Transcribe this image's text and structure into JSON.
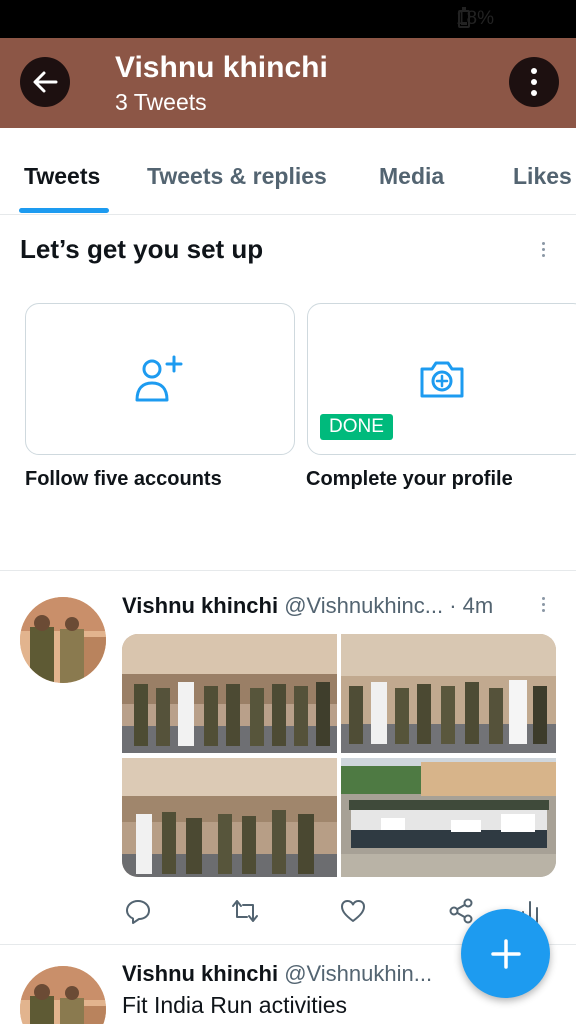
{
  "status_bar": {
    "battery": "18%"
  },
  "header": {
    "name": "Vishnu khinchi",
    "tweet_count": "3 Tweets"
  },
  "tabs": [
    {
      "label": "Tweets",
      "active": true
    },
    {
      "label": "Tweets & replies",
      "active": false
    },
    {
      "label": "Media",
      "active": false
    },
    {
      "label": "Likes",
      "active": false
    }
  ],
  "setup": {
    "title": "Let’s get you set up",
    "cards": [
      {
        "label": "Follow five accounts",
        "icon": "add-user-icon"
      },
      {
        "label": "Complete your profile",
        "icon": "camera-plus-icon",
        "badge": "DONE"
      }
    ]
  },
  "tweets": [
    {
      "name": "Vishnu khinchi",
      "handle": "@Vishnukhinc...",
      "time": "· 4m",
      "media_count": 4
    },
    {
      "name": "Vishnu khinchi",
      "handle": "@Vishnukhin...",
      "text": "Fit India Run activities"
    }
  ],
  "actions": [
    "reply-icon",
    "retweet-icon",
    "like-icon",
    "share-icon",
    "analytics-icon"
  ],
  "fab": {
    "icon": "plus-icon"
  },
  "colors": {
    "header_bg": "#8c5646",
    "accent": "#1d9bf0",
    "done": "#00ba7c"
  }
}
